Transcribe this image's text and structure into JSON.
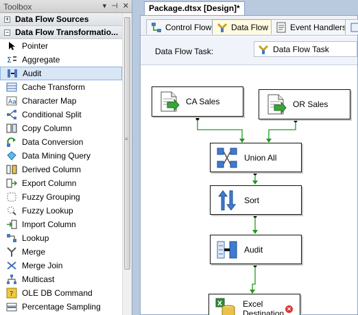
{
  "toolbox": {
    "title": "Toolbox",
    "window_buttons": [
      "▾",
      "⊣",
      "✕"
    ],
    "categories": [
      {
        "label": "Data Flow Sources",
        "expanded": false
      },
      {
        "label": "Data Flow Transformatio...",
        "expanded": true
      }
    ],
    "items": [
      {
        "label": "Pointer",
        "icon": "pointer-icon"
      },
      {
        "label": "Aggregate",
        "icon": "aggregate-icon"
      },
      {
        "label": "Audit",
        "icon": "audit-icon",
        "selected": true
      },
      {
        "label": "Cache Transform",
        "icon": "cache-transform-icon"
      },
      {
        "label": "Character Map",
        "icon": "character-map-icon"
      },
      {
        "label": "Conditional Split",
        "icon": "conditional-split-icon"
      },
      {
        "label": "Copy Column",
        "icon": "copy-column-icon"
      },
      {
        "label": "Data Conversion",
        "icon": "data-conversion-icon"
      },
      {
        "label": "Data Mining Query",
        "icon": "data-mining-query-icon"
      },
      {
        "label": "Derived Column",
        "icon": "derived-column-icon"
      },
      {
        "label": "Export Column",
        "icon": "export-column-icon"
      },
      {
        "label": "Fuzzy Grouping",
        "icon": "fuzzy-grouping-icon"
      },
      {
        "label": "Fuzzy Lookup",
        "icon": "fuzzy-lookup-icon"
      },
      {
        "label": "Import Column",
        "icon": "import-column-icon"
      },
      {
        "label": "Lookup",
        "icon": "lookup-icon"
      },
      {
        "label": "Merge",
        "icon": "merge-icon"
      },
      {
        "label": "Merge Join",
        "icon": "merge-join-icon"
      },
      {
        "label": "Multicast",
        "icon": "multicast-icon"
      },
      {
        "label": "OLE DB Command",
        "icon": "ole-db-command-icon"
      },
      {
        "label": "Percentage Sampling",
        "icon": "percentage-sampling-icon"
      }
    ]
  },
  "document": {
    "tab_title": "Package.dtsx [Design]*",
    "designer_tabs": [
      {
        "label": "Control Flow",
        "active": false
      },
      {
        "label": "Data Flow",
        "active": true
      },
      {
        "label": "Event Handlers",
        "active": false
      },
      {
        "label": "P",
        "active": false
      }
    ],
    "task_label": "Data Flow Task:",
    "task_value": "Data Flow Task"
  },
  "flow": {
    "nodes": [
      {
        "id": "ca-sales",
        "label": "CA Sales",
        "icon": "ole-db-source-icon"
      },
      {
        "id": "or-sales",
        "label": "OR Sales",
        "icon": "ole-db-source-icon"
      },
      {
        "id": "union-all",
        "label": "Union All",
        "icon": "union-all-icon"
      },
      {
        "id": "sort",
        "label": "Sort",
        "icon": "sort-icon"
      },
      {
        "id": "audit",
        "label": "Audit",
        "icon": "audit-icon"
      },
      {
        "id": "excel-destination",
        "label": "Excel\nDestination",
        "icon": "excel-destination-icon",
        "has_error": true
      }
    ]
  },
  "colors": {
    "path_green": "#1e9a1e",
    "selection": "#d8e6f6",
    "designer_frame": "#b9c9de"
  }
}
